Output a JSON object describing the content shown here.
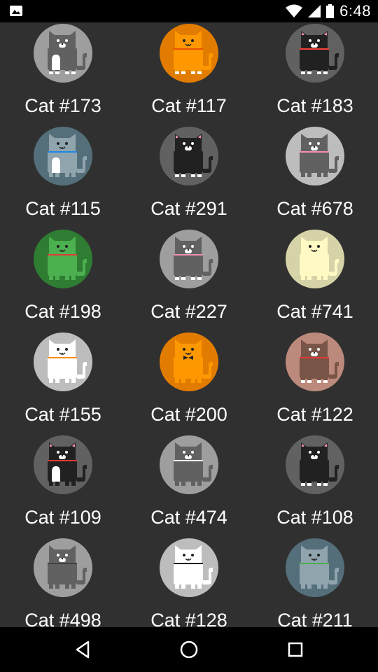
{
  "status_bar": {
    "time": "6:48",
    "icons": [
      "image-notification-icon",
      "wifi-icon",
      "cell-signal-icon",
      "battery-icon"
    ]
  },
  "cats": [
    {
      "label": "Cat #173",
      "bg": "#9e9e9e",
      "body": "#616161",
      "collar": null,
      "bow": false,
      "belly": "#ffffff",
      "ear": "#616161",
      "paws": true
    },
    {
      "label": "Cat #117",
      "bg": "#e27c00",
      "body": "#ff9800",
      "collar": "#e65100",
      "bow": false,
      "belly": null,
      "ear": "#ff9800",
      "paws": true
    },
    {
      "label": "Cat #183",
      "bg": "#616161",
      "body": "#212121",
      "collar": "#f44336",
      "bow": false,
      "belly": null,
      "ear": "#f48fb1",
      "paws": true
    },
    {
      "label": "Cat #115",
      "bg": "#546e7a",
      "body": "#90a4ae",
      "collar": "#1e88e5",
      "bow": false,
      "belly": "#ffffff",
      "ear": "#90a4ae",
      "paws": false
    },
    {
      "label": "Cat #291",
      "bg": "#616161",
      "body": "#212121",
      "collar": null,
      "bow": false,
      "belly": null,
      "ear": "#f48fb1",
      "paws": true
    },
    {
      "label": "Cat #678",
      "bg": "#bdbdbd",
      "body": "#616161",
      "collar": "#f48fb1",
      "bow": false,
      "belly": null,
      "ear": "#616161",
      "paws": false
    },
    {
      "label": "Cat #198",
      "bg": "#2e7d32",
      "body": "#4caf50",
      "collar": "#e53935",
      "bow": false,
      "belly": null,
      "ear": "#4caf50",
      "paws": false
    },
    {
      "label": "Cat #227",
      "bg": "#9e9e9e",
      "body": "#616161",
      "collar": "#f48fb1",
      "bow": false,
      "belly": null,
      "ear": "#616161",
      "paws": true
    },
    {
      "label": "Cat #741",
      "bg": "#d7d3a8",
      "body": "#fff9c4",
      "collar": null,
      "bow": false,
      "belly": null,
      "ear": "#fff9c4",
      "paws": false
    },
    {
      "label": "Cat #155",
      "bg": "#bdbdbd",
      "body": "#ffffff",
      "collar": "#fb8c00",
      "bow": false,
      "belly": null,
      "ear": "#ffffff",
      "paws": false
    },
    {
      "label": "Cat #200",
      "bg": "#e27c00",
      "body": "#ff9800",
      "collar": null,
      "bow": true,
      "belly": null,
      "ear": "#ff9800",
      "paws": false
    },
    {
      "label": "Cat #122",
      "bg": "#bc8a7c",
      "body": "#795548",
      "collar": "#e53935",
      "bow": false,
      "belly": null,
      "ear": "#795548",
      "paws": true
    },
    {
      "label": "Cat #109",
      "bg": "#616161",
      "body": "#212121",
      "collar": "#e53935",
      "bow": false,
      "belly": "#ffffff",
      "ear": "#f48fb1",
      "paws": false
    },
    {
      "label": "Cat #474",
      "bg": "#9e9e9e",
      "body": "#616161",
      "collar": "#ffffff",
      "bow": false,
      "belly": null,
      "ear": "#616161",
      "paws": false
    },
    {
      "label": "Cat #108",
      "bg": "#616161",
      "body": "#212121",
      "collar": null,
      "bow": false,
      "belly": null,
      "ear": "#f48fb1",
      "paws": true
    },
    {
      "label": "Cat #498",
      "bg": "#9e9e9e",
      "body": "#616161",
      "collar": "#424242",
      "bow": false,
      "belly": null,
      "ear": "#616161",
      "paws": false
    },
    {
      "label": "Cat #128",
      "bg": "#bdbdbd",
      "body": "#ffffff",
      "collar": "#212121",
      "bow": false,
      "belly": null,
      "ear": "#ffffff",
      "paws": false
    },
    {
      "label": "Cat #211",
      "bg": "#546e7a",
      "body": "#90a4ae",
      "collar": "#4caf50",
      "bow": false,
      "belly": null,
      "ear": "#90a4ae",
      "paws": false
    }
  ],
  "nav_bar": {
    "back": "back-icon",
    "home": "home-icon",
    "recents": "recents-icon"
  }
}
